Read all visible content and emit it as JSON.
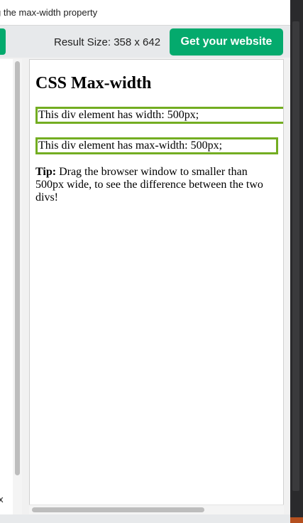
{
  "window": {
    "title": "g the max-width property"
  },
  "toolbar": {
    "result_size": "Result Size: 358 x 642",
    "get_website_label": "Get your website"
  },
  "code_pane": {
    "fragment": "x"
  },
  "result": {
    "heading": "CSS Max-width",
    "div_width_text": "This div element has width: 500px;",
    "div_maxwidth_text": "This div element has max-width: 500px;",
    "tip_label": "Tip:",
    "tip_text": " Drag the browser window to smaller than 500px wide, to see the difference between the two divs!"
  },
  "colors": {
    "accent_green": "#04aa6d",
    "border_green": "#73ad21"
  }
}
